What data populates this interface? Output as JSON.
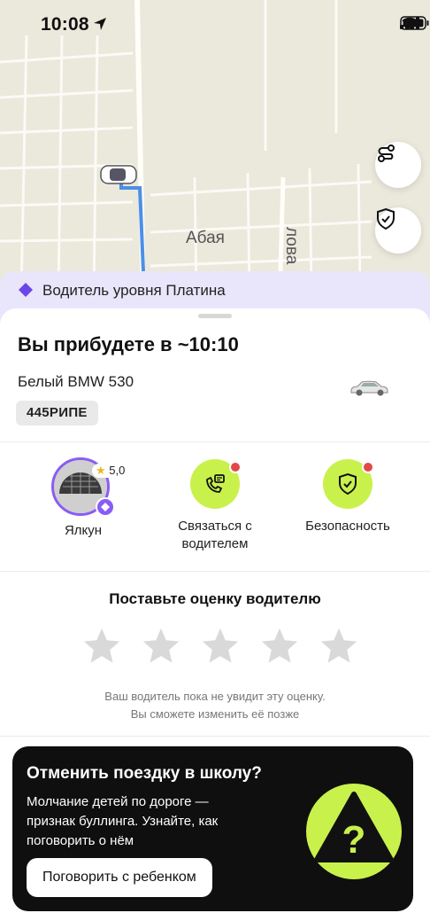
{
  "status_bar": {
    "time": "10:08"
  },
  "map": {
    "street_label_1": "Абая",
    "street_label_2": "лова"
  },
  "level_banner": {
    "text": "Водитель уровня Платина"
  },
  "trip": {
    "eta": "Вы прибудете в ~10:10",
    "car_model": "Белый BMW 530",
    "plate": "445РИПЕ"
  },
  "actions": {
    "driver_name": "Ялкун",
    "driver_rating": "5,0",
    "contact_label_line1": "Связаться с",
    "contact_label_line2": "водителем",
    "safety_label": "Безопасность"
  },
  "rating": {
    "title": "Поставьте оценку водителю",
    "stars": 5,
    "note_line1": "Ваш водитель пока не увидит эту оценку.",
    "note_line2": "Вы сможете изменить её позже"
  },
  "promo": {
    "title": "Отменить поездку в школу?",
    "text": "Молчание детей по дороге — признак буллинга. Узнайте, как поговорить о нём",
    "button": "Поговорить с ребенком"
  },
  "colors": {
    "accent_green": "#c9f14c",
    "accent_purple": "#8a5cf6",
    "route_blue": "#4a8fe8",
    "notification_red": "#e34848"
  }
}
